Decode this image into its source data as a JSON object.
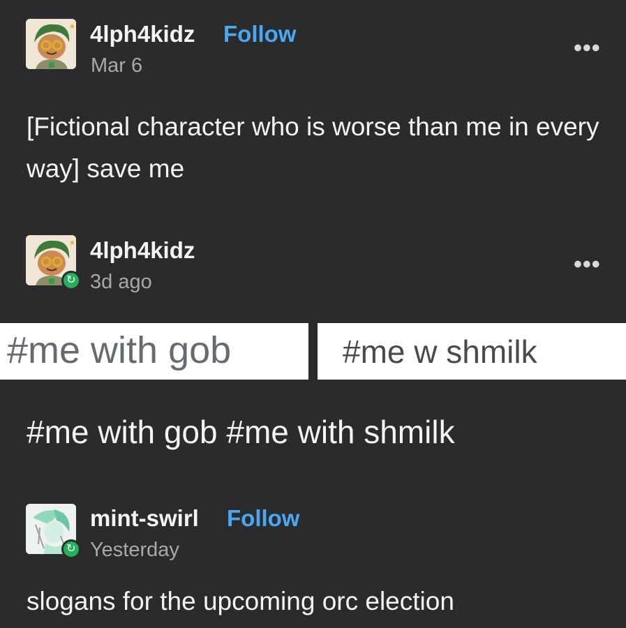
{
  "post1": {
    "username": "4lph4kidz",
    "follow_label": "Follow",
    "timestamp": "Mar 6",
    "more_label": "•••",
    "body": "[Fictional character who is worse than me in every way] save me"
  },
  "post2": {
    "username": "4lph4kidz",
    "timestamp": "3d ago",
    "more_label": "•••",
    "reblog_icon": "↻"
  },
  "tag_panels": {
    "left": "#me with gob",
    "right": "#me w shmilk"
  },
  "post2_tags": "#me with gob #me with shmilk",
  "post3": {
    "username": "mint-swirl",
    "follow_label": "Follow",
    "timestamp": "Yesterday",
    "reblog_icon": "↻",
    "body": "slogans for the upcoming orc election"
  },
  "colors": {
    "background": "#2b2b2d",
    "follow_blue": "#4aa8f0",
    "reblog_green": "#25b05a",
    "timestamp_gray": "#a9a9ab"
  }
}
